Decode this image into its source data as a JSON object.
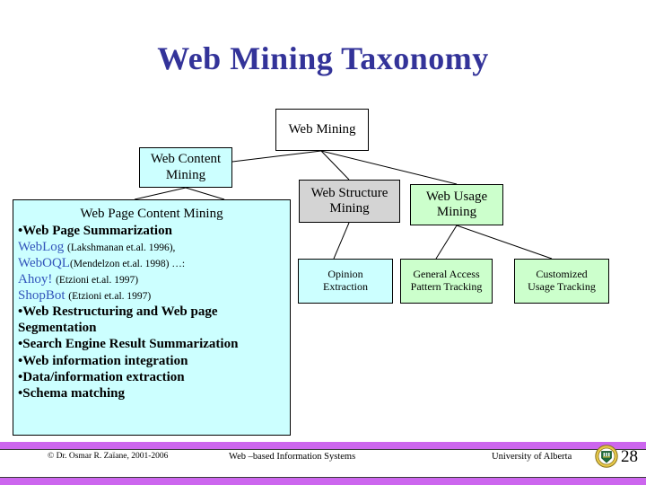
{
  "slide": {
    "title": "Web Mining Taxonomy",
    "title_color": "#333399",
    "background": "#ffffff"
  },
  "diagram": {
    "nodes": [
      {
        "id": "web-mining",
        "label": "Web Mining",
        "fill": "#ffffff"
      },
      {
        "id": "web-content",
        "label": "Web Content Mining",
        "fill": "#ccffff"
      },
      {
        "id": "web-structure",
        "label": "Web Structure Mining",
        "fill": "#d4d4d4"
      },
      {
        "id": "web-usage",
        "label": "Web Usage Mining",
        "fill": "#ccffcc"
      },
      {
        "id": "opinion",
        "label": "Opinion Extraction",
        "fill": "#ccffff"
      },
      {
        "id": "general-access",
        "label": "General Access Pattern Tracking",
        "fill": "#ccffcc"
      },
      {
        "id": "customized-usage",
        "label": "Customized Usage Tracking",
        "fill": "#ccffcc"
      }
    ],
    "node_labels": {
      "web_mining_l1": "Web Mining",
      "web_content_l1": "Web Content",
      "web_content_l2": "Mining",
      "web_structure_l1": "Web Structure",
      "web_structure_l2": "Mining",
      "web_usage_l1": "Web Usage",
      "web_usage_l2": "Mining",
      "opinion_l1": "Opinion",
      "opinion_l2": "Extraction",
      "general_l1": "General Access",
      "general_l2": "Pattern Tracking",
      "customized_l1": "Customized",
      "customized_l2": "Usage Tracking"
    }
  },
  "detail_panel": {
    "fill": "#ccffff",
    "heading": "Web Page Content Mining",
    "bullet1": "Web Page Summarization",
    "refs": [
      {
        "name": "WebLog",
        "cite": "(Lakshmanan et.al. 1996),"
      },
      {
        "name": "WebOQL",
        "cite": "(Mendelzon et.al. 1998) …:"
      },
      {
        "name": "Ahoy!",
        "cite": "(Etzioni et.al. 1997)"
      },
      {
        "name": "ShopBot",
        "cite": "(Etzioni et.al. 1997)"
      }
    ],
    "ref_color": "#3355bb",
    "bullets": [
      "Web Restructuring and Web page Segmentation",
      "Search Engine Result Summarization",
      "Web information integration",
      "Data/information extraction",
      "Schema matching"
    ],
    "bullet_glyph": "•"
  },
  "footer": {
    "copyright": "© Dr. Osmar R. Zaïane, 2001-2006",
    "course": "Web –based Information Systems",
    "university": "University of Alberta",
    "page_number": "28",
    "bar_color": "#cc66ee"
  }
}
